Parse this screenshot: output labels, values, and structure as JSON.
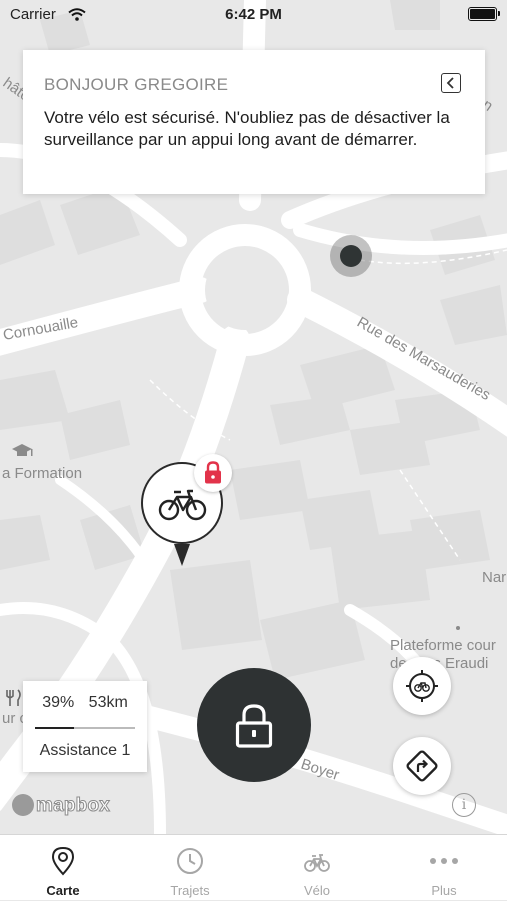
{
  "status_bar": {
    "carrier": "Carrier",
    "time": "6:42 PM"
  },
  "card": {
    "greeting": "BONJOUR GREGOIRE",
    "message": "Votre vélo est sécurisé. N'oubliez pas de désactiver la surveillance par un appui long avant de démarrer."
  },
  "map": {
    "street_labels": [
      "Cornouaille",
      "Rue des Marsauderies",
      "Boyer",
      "Nar",
      "hâte",
      "ièn",
      "ur c"
    ],
    "poi_labels": [
      "a Formation",
      "Plateforme cour",
      "de",
      "es Eraudi"
    ]
  },
  "bike_stats": {
    "battery": "39%",
    "range": "53km",
    "battery_level": 0.39,
    "assist": "Assistance 1"
  },
  "attribution": {
    "mapbox": "mapbox",
    "info": "i"
  },
  "tabs": [
    {
      "label": "Carte",
      "icon": "map-pin-icon",
      "active": true
    },
    {
      "label": "Trajets",
      "icon": "clock-icon",
      "active": false
    },
    {
      "label": "Vélo",
      "icon": "bicycle-icon",
      "active": false
    },
    {
      "label": "Plus",
      "icon": "more-dots-icon",
      "active": false
    }
  ],
  "colors": {
    "accent_red": "#e2334a",
    "dark": "#2e3233",
    "map_bg": "#e8e8e8",
    "road": "#ffffff"
  }
}
